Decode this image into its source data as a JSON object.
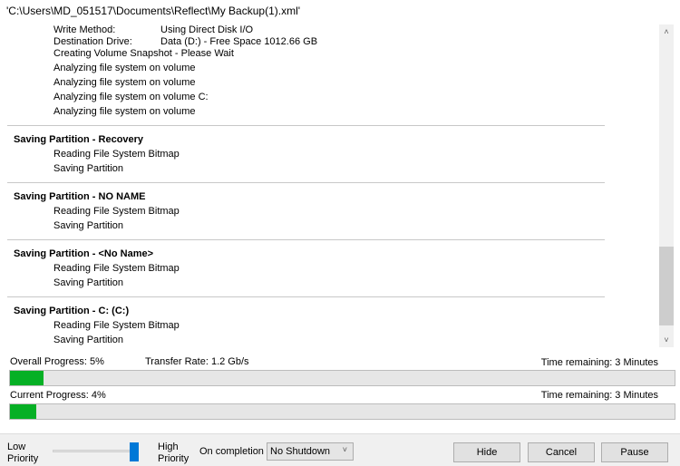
{
  "title": "'C:\\Users\\MD_051517\\Documents\\Reflect\\My Backup(1).xml'",
  "log": {
    "write_method_label": "Write Method:",
    "write_method_value": "Using Direct Disk I/O",
    "dest_label": "Destination Drive:",
    "dest_value": "Data (D:) - Free Space 1012.66 GB",
    "lines": [
      "Creating Volume Snapshot - Please Wait",
      "Analyzing file system on volume",
      "Analyzing file system on volume",
      "Analyzing file system on volume C:",
      "Analyzing file system on volume"
    ],
    "sections": [
      {
        "title": "Saving Partition - Recovery",
        "lines": [
          "Reading File System Bitmap",
          "Saving Partition"
        ]
      },
      {
        "title": "Saving Partition - NO NAME",
        "lines": [
          "Reading File System Bitmap",
          "Saving Partition"
        ]
      },
      {
        "title": "Saving Partition - <No Name>",
        "lines": [
          "Reading File System Bitmap",
          "Saving Partition"
        ]
      },
      {
        "title": "Saving Partition - C: (C:)",
        "lines": [
          "Reading File System Bitmap",
          "Saving Partition"
        ]
      }
    ]
  },
  "progress": {
    "overall_label": "Overall Progress:  5%",
    "overall_percent": 5,
    "transfer_rate": "Transfer Rate: 1.2 Gb/s",
    "overall_time": "Time remaining: 3 Minutes",
    "current_label": "Current Progress:  4%",
    "current_percent": 4,
    "current_time": "Time remaining: 3 Minutes",
    "color": "#06b025"
  },
  "footer": {
    "low": "Low",
    "low2": "Priority",
    "high": "High",
    "high2": "Priority",
    "priority_level": 1.0,
    "on_completion": "On completion",
    "completion_value": "No Shutdown",
    "hide": "Hide",
    "cancel": "Cancel",
    "pause": "Pause"
  }
}
